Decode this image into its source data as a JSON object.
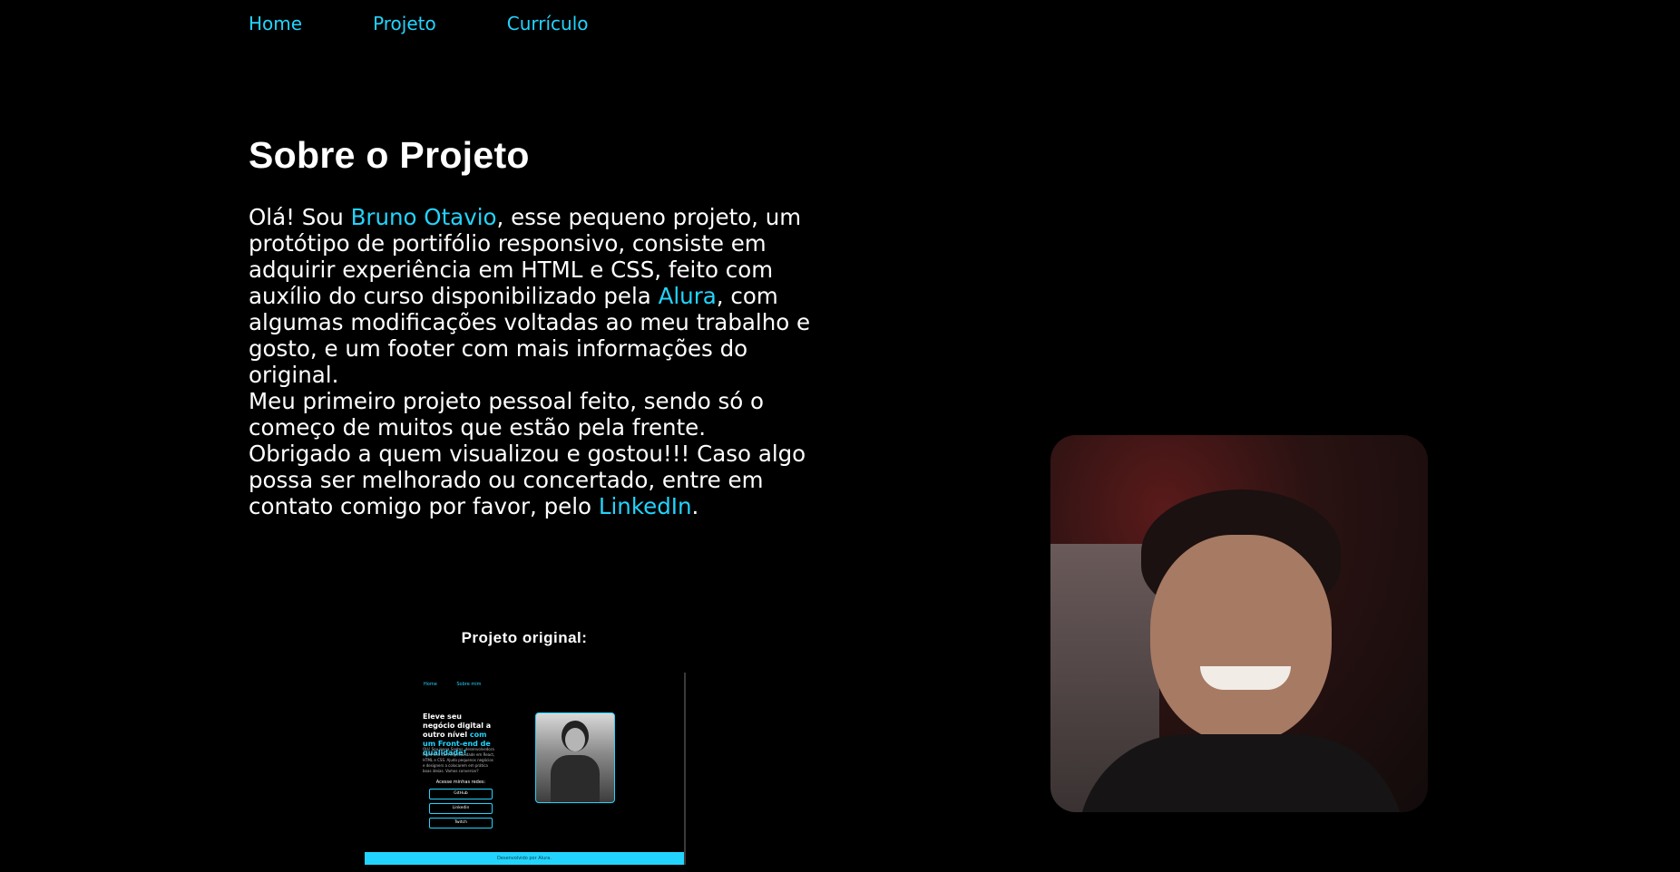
{
  "nav": {
    "home": "Home",
    "projeto": "Projeto",
    "curriculo": "Currículo"
  },
  "about": {
    "title": "Sobre o Projeto",
    "p1_a": "Olá! Sou ",
    "name": "Bruno Otavio",
    "p1_b": ", esse pequeno projeto, um protótipo de portifólio responsivo, consiste em adquirir experiência em HTML e CSS, feito com auxílio do curso disponibilizado pela ",
    "alura": "Alura",
    "p1_c": ", com algumas modificações voltadas ao meu trabalho e gosto, e um footer com mais informações do original.",
    "p2": "Meu primeiro projeto pessoal feito, sendo só o começo de muitos que estão pela frente.",
    "p3_a": "Obrigado a quem visualizou e gostou!!! Caso algo possa ser melhorado ou concertado, entre em contato comigo por favor, pelo ",
    "linkedin": "LinkedIn",
    "p3_b": "."
  },
  "original": {
    "label": "Projeto original:",
    "nav_home": "Home",
    "nav_about": "Sobre mim",
    "headline_a": "Eleve seu negócio digital a outro nível ",
    "headline_b": "com um Front-end de qualidade!",
    "description": "Olá! Sou Joana Santos, desenvolvedora Front-end com especialidade em React, HTML e CSS. Ajudo pequenos negócios e designers a colocarem em prática boas ideias. Vamos conversar?",
    "social_label": "Acesse minhas redes:",
    "btn_github": "GitHub",
    "btn_linkedin": "Linkedin",
    "btn_twitch": "Twitch",
    "footer": "Desenvolvido por Alura."
  },
  "colors": {
    "accent": "#22d4fd",
    "background": "#000000",
    "text": "#ffffff"
  }
}
